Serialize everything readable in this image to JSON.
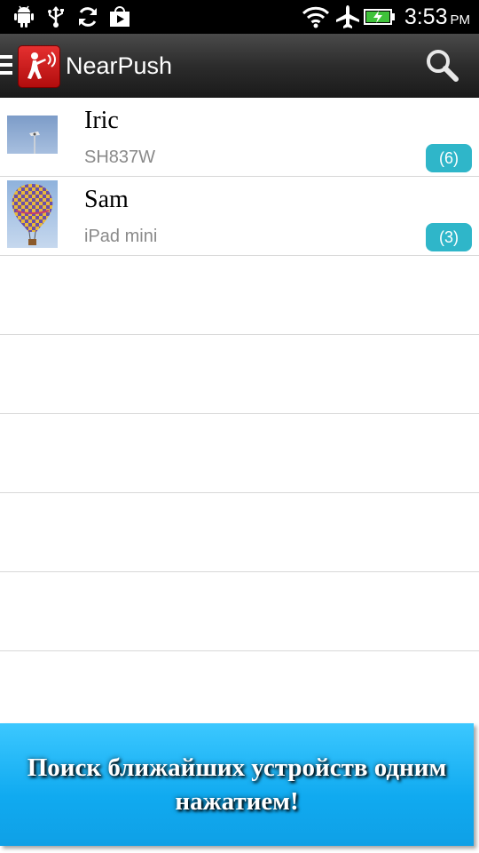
{
  "status_bar": {
    "time": "3:53",
    "ampm": "PM",
    "icons": [
      "android-debug-icon",
      "usb-icon",
      "sync-icon",
      "play-store-icon",
      "wifi-icon",
      "airplane-icon",
      "battery-charging-icon"
    ]
  },
  "action_bar": {
    "title": "NearPush",
    "icons": [
      "menu-icon",
      "app-logo-icon",
      "search-icon"
    ]
  },
  "devices": [
    {
      "name": "Iric",
      "model": "SH837W",
      "count": "(6)"
    },
    {
      "name": "Sam",
      "model": "iPad mini",
      "count": "(3)"
    }
  ],
  "colors": {
    "badge": "#2fb6c9",
    "banner": "#10aaf0",
    "logo": "#d01818"
  },
  "promo": {
    "text": "Поиск ближайших устройств одним нажатием!"
  }
}
